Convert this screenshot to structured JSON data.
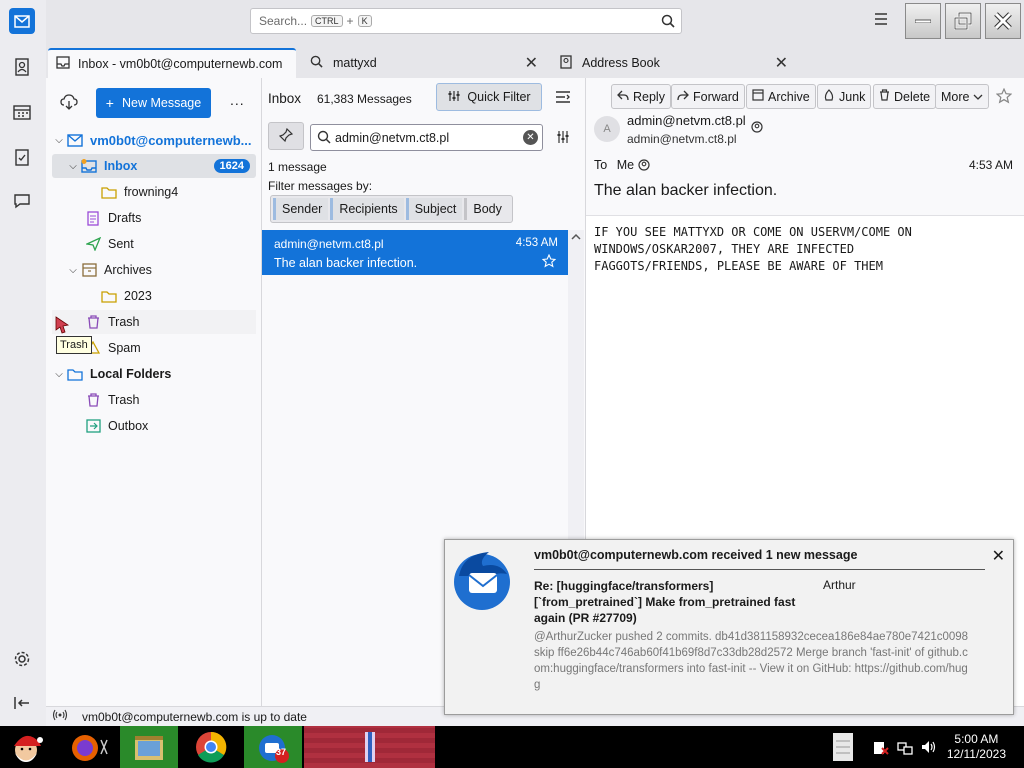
{
  "window": {
    "search_placeholder": "Search...",
    "shortcut_mod": "CTRL",
    "shortcut_plus": "+",
    "shortcut_key": "K"
  },
  "tabs": [
    {
      "label": "Inbox - vm0b0t@computernewb.com"
    },
    {
      "label": "mattyxd"
    },
    {
      "label": "Address Book"
    }
  ],
  "folder_pane": {
    "new_message": "New Message",
    "more": "...",
    "account": "vm0b0t@computernewb...",
    "folders": [
      {
        "label": "Inbox",
        "badge": "1624"
      },
      {
        "label": "frowning4"
      },
      {
        "label": "Drafts"
      },
      {
        "label": "Sent"
      },
      {
        "label": "Archives"
      },
      {
        "label": "2023"
      },
      {
        "label": "Trash"
      },
      {
        "label": "Spam"
      }
    ],
    "local_folders": "Local Folders",
    "local": [
      {
        "label": "Trash"
      },
      {
        "label": "Outbox"
      }
    ],
    "tooltip": "Trash"
  },
  "thread_pane": {
    "title": "Inbox",
    "count": "61,383 Messages",
    "quick_filter": "Quick Filter",
    "filter_value": "admin@netvm.ct8.pl",
    "result": "1 message",
    "filter_by": "Filter messages by:",
    "chips": [
      "Sender",
      "Recipients",
      "Subject",
      "Body"
    ],
    "messages": [
      {
        "from": "admin@netvm.ct8.pl",
        "time": "4:53 AM",
        "subject": "The alan backer infection."
      }
    ]
  },
  "message_pane": {
    "toolbar": [
      "Reply",
      "Forward",
      "Archive",
      "Junk",
      "Delete",
      "More"
    ],
    "avatar_letter": "A",
    "from_name": "admin@netvm.ct8.pl",
    "from_addr": "admin@netvm.ct8.pl",
    "to_label": "To",
    "to_value": "Me",
    "time": "4:53 AM",
    "subject": "The alan backer infection.",
    "body": "IF YOU SEE MATTYXD OR COME ON USERVM/COME ON\nWINDOWS/OSKAR2007, THEY ARE INFECTED\nFAGGOTS/FRIENDS, PLEASE BE AWARE OF THEM"
  },
  "status": {
    "text": "vm0b0t@computernewb.com is up to date"
  },
  "notification": {
    "title": "vm0b0t@computernewb.com received 1 new message",
    "subject": "Re: [huggingface/transformers] [`from_pretrained`] Make from_pretrained fast again (PR #27709)",
    "from": "Arthur",
    "preview": "@ArthurZucker pushed 2 commits. db41d381158932cecea186e84ae780e7421c0098 skip ff6e26b44c746ab60f41b69f8d7c33db28d2572 Merge branch 'fast-init' of github.com:huggingface/transformers into fast-init -- View it on GitHub: https://github.com/hugg"
  },
  "taskbar": {
    "time": "5:00 AM",
    "date": "12/11/2023",
    "tb_badge": "37"
  },
  "colors": {
    "accent": "#1373d9",
    "selected_row": "#1373d9"
  }
}
